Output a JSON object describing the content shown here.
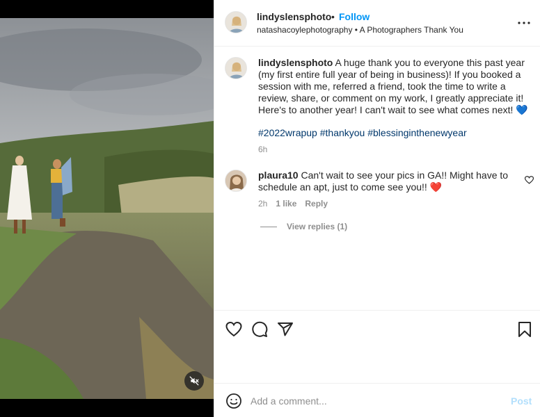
{
  "post": {
    "username": "lindyslensphoto",
    "separator": "•",
    "follow_label": "Follow",
    "tagged_account": "natashacoylephotography",
    "sub_separator": "•",
    "audio_title": "A Photographers Thank You"
  },
  "caption": {
    "username": "lindyslensphoto",
    "text": " A huge thank you to everyone this past year (my first entire full year of being in business)! If you booked a session with me, referred a friend, took the time to write a review, share, or comment on my work, I greatly appreciate it! Here's to another year! I can't wait to see what comes next! 💙",
    "hashtags": "#2022wrapup #thankyou #blessinginthenewyear",
    "time": "6h"
  },
  "comments": [
    {
      "username": "plaura10",
      "text": " Can't wait to see your pics in GA!! Might have to schedule an apt, just to come see you!! ❤️",
      "time": "2h",
      "likes": "1 like",
      "reply_label": "Reply",
      "view_replies": "View replies (1)"
    }
  ],
  "add_comment": {
    "placeholder": "Add a comment...",
    "post_label": "Post"
  },
  "icons": {
    "more": "more-options-icon",
    "like": "heart-icon",
    "comment": "comment-icon",
    "share": "share-icon",
    "save": "bookmark-icon",
    "emoji": "emoji-icon",
    "mute": "muted-speaker-icon",
    "comment_like": "small-heart-icon"
  },
  "colors": {
    "accent": "#0095f6",
    "hashtag": "#00376b",
    "muted_text": "#8e8e8e",
    "post_disabled": "#b2dffc"
  }
}
